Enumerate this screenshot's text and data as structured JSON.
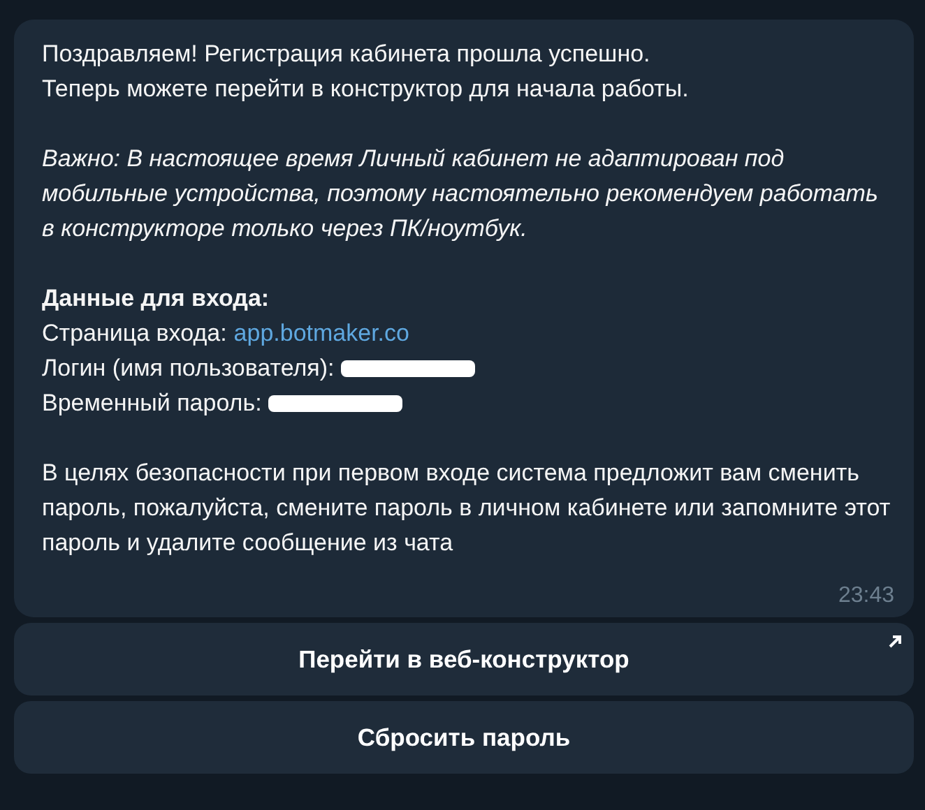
{
  "message": {
    "blocks": [
      {
        "kind": "plain",
        "lines": [
          "Поздравляем! Регистрация кабинета прошла успешно.",
          "Теперь можете перейти в конструктор для начала работы."
        ]
      },
      {
        "kind": "italic",
        "lines": [
          "Важно: В настоящее время Личный кабинет не адаптирован под мобильные устройства, поэтому настоятельно рекомендуем работать в конструкторе только через ПК/ноутбук."
        ]
      },
      {
        "kind": "credentials",
        "heading": "Данные для входа:",
        "fields": [
          {
            "label": "Страница входа:",
            "value": "app.botmaker.co",
            "redacted": false
          },
          {
            "label": "Логин (имя пользователя):",
            "redacted": true
          },
          {
            "label": "Временный пароль:",
            "redacted": true
          }
        ]
      },
      {
        "kind": "plain",
        "lines": [
          "В целях безопасности при первом входе система предложит вам сменить пароль, пожалуйста, смените пароль в личном кабинете или запомните этот пароль и удалите сообщение из чата"
        ]
      }
    ],
    "time": "23:43"
  },
  "buttons": [
    {
      "label": "Перейти в веб-конструктор",
      "external": true
    },
    {
      "label": "Сбросить пароль",
      "external": false
    }
  ]
}
